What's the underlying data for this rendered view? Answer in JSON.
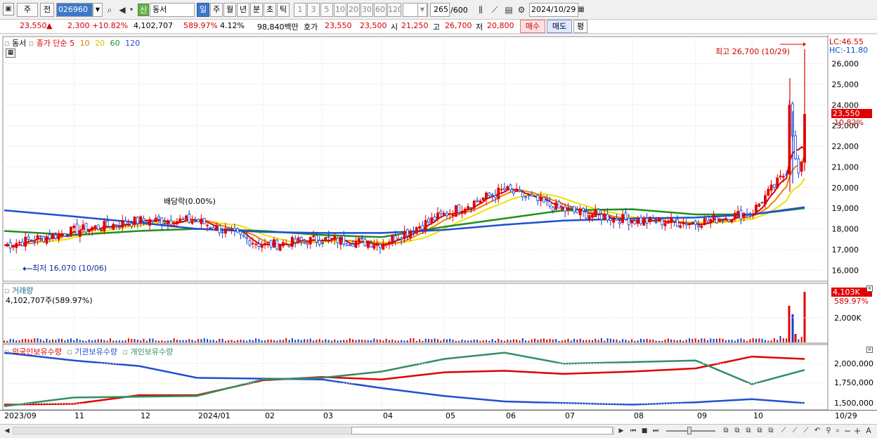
{
  "toolbar": {
    "type_select": "주",
    "prev_label": "전",
    "code": "026960",
    "name": "동서",
    "period_buttons": [
      "일",
      "주",
      "월",
      "년",
      "분",
      "초",
      "틱"
    ],
    "selected_period": "일",
    "interval_buttons": [
      "1",
      "3",
      "5",
      "10",
      "20",
      "30",
      "60",
      "120"
    ],
    "count": "265",
    "count_total": "/600",
    "date": "2024/10/29",
    "new_badge": "신"
  },
  "quote": {
    "price": "23,550",
    "arrow": "▲",
    "change": "2,300",
    "change_pct": "+10.82%",
    "volume": "4,102,707",
    "volume_ratio": "589.97%",
    "turnover": "4.12%",
    "amount": "98,840백만",
    "bid_label": "호가",
    "bid1": "23,550",
    "bid2": "23,500",
    "open_label": "시",
    "open": "21,250",
    "high_label": "고",
    "high": "26,700",
    "low_label": "저",
    "low": "20,800",
    "buy_label": "매수",
    "sell_label": "매도",
    "eval_label": "평"
  },
  "price_panel": {
    "legend_name": "동서",
    "legend_type": "종가 단순",
    "ma_periods": [
      "5",
      "10",
      "20",
      "60",
      "120"
    ],
    "lc": "LC:46.55",
    "hc": "HC:-11.80",
    "high_annot": "최고 26,700 (10/29)",
    "low_annot": "최저 16,070 (10/06)",
    "div_annot": "배당락(0.00%)",
    "current_price_tag": "23,550",
    "current_pct_tag": "10.82%",
    "y_ticks": [
      "26,000",
      "25,000",
      "24,000",
      "23,000",
      "22,000",
      "21,000",
      "20,000",
      "19,000",
      "18,000",
      "17,000",
      "16,000"
    ]
  },
  "volume_panel": {
    "title": "거래량",
    "value": "4,102,707주(589.97%)",
    "tag": "4,103K",
    "tag_pct": "589.97%",
    "y_tick": "2,000K"
  },
  "holding_panel": {
    "legends": [
      "외국인보유수량",
      "기관보유수량",
      "개인보유수량"
    ],
    "y_ticks": [
      "2,000,000",
      "1,750,000",
      "1,500,000"
    ]
  },
  "x_axis": [
    "2023/09",
    "11",
    "12",
    "2024/01",
    "02",
    "03",
    "04",
    "05",
    "06",
    "07",
    "08",
    "09",
    "10",
    "10/29"
  ],
  "colors": {
    "ma5": "#e00000",
    "ma10": "#f08000",
    "ma20": "#f0e000",
    "ma60": "#209020",
    "ma120": "#2050d0",
    "up": "#e00000",
    "down": "#1040d0",
    "foreign": "#e00000",
    "institution": "#2050d0",
    "individual": "#309060"
  },
  "chart_data": {
    "type": "line",
    "title": "동서",
    "x": [
      "2023/09",
      "11",
      "12",
      "2024/01",
      "02",
      "03",
      "04",
      "05",
      "06",
      "07",
      "08",
      "09",
      "10",
      "10/29"
    ],
    "series": [
      {
        "name": "5",
        "values": [
          17200,
          17900,
          18400,
          18400,
          17200,
          17500,
          17300,
          18700,
          19900,
          18900,
          18400,
          18300,
          18800,
          21800
        ]
      },
      {
        "name": "60",
        "values": [
          17900,
          17700,
          17900,
          18000,
          17900,
          17700,
          17600,
          18100,
          18500,
          18900,
          18950,
          18700,
          18700,
          19000
        ]
      },
      {
        "name": "120",
        "values": [
          18900,
          18600,
          18300,
          18000,
          17850,
          17800,
          17800,
          17950,
          18200,
          18400,
          18500,
          18550,
          18700,
          19050
        ]
      }
    ],
    "ylim": [
      15600,
      26700
    ],
    "high": 26700,
    "low": 16070,
    "last_close": 23550
  }
}
